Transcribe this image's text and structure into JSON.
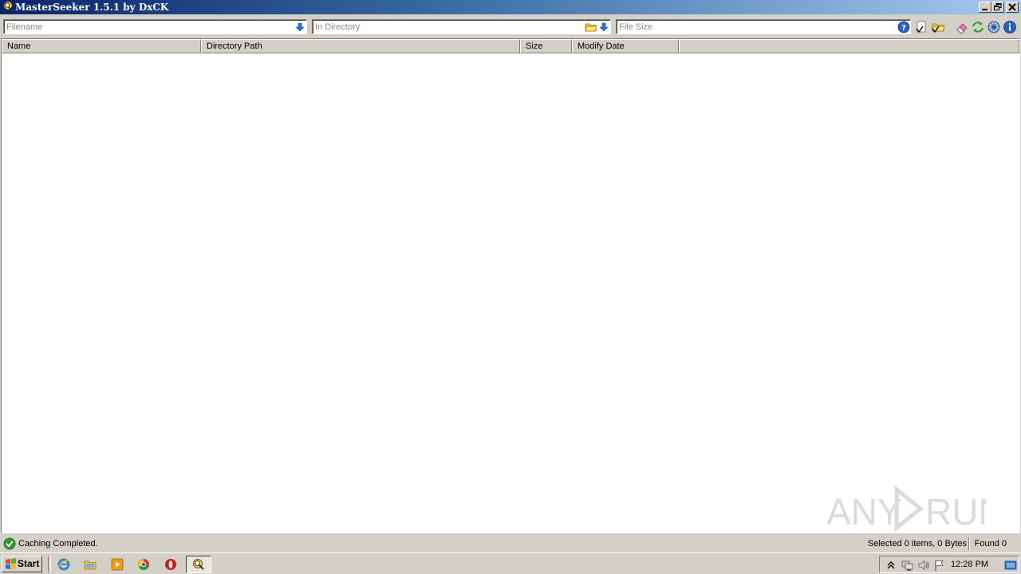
{
  "window": {
    "title": "MasterSeeker 1.5.1 by DxCK"
  },
  "search": {
    "filename_placeholder": "Filename",
    "directory_placeholder": "In Directory",
    "filesize_placeholder": "File Size"
  },
  "table": {
    "columns": [
      "Name",
      "Directory Path",
      "Size",
      "Modify Date"
    ],
    "rows": []
  },
  "status": {
    "message": "Caching Completed.",
    "selected": "Selected 0 items, 0 Bytes",
    "found": "Found 0"
  },
  "watermark": {
    "text": "ANY RUN"
  },
  "taskbar": {
    "start_label": "Start",
    "clock": "12:28 PM",
    "pinned": [
      "internet-explorer-icon",
      "explorer-icon",
      "media-player-icon",
      "chrome-icon",
      "opera-icon"
    ],
    "active_task": "masterseeker-icon"
  },
  "colors": {
    "title_gradient_start": "#0a246a",
    "title_gradient_end": "#a6caf0",
    "chrome": "#d4d0c8",
    "status_ok": "#2e9a2e"
  }
}
